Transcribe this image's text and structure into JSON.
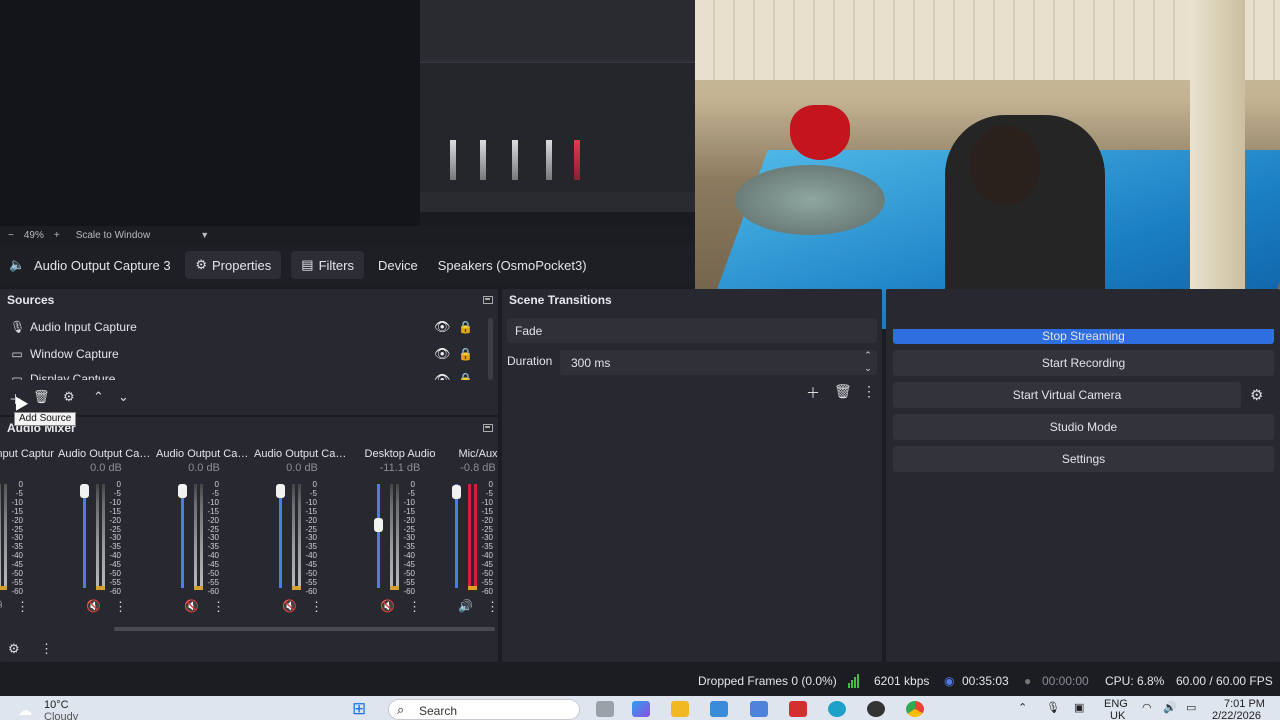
{
  "preview": {
    "zoom": "49%",
    "scale_mode": "Scale to Window"
  },
  "context_bar": {
    "source_name": "Audio Output Capture 3",
    "properties_label": "Properties",
    "filters_label": "Filters",
    "device_label": "Device",
    "device_value": "Speakers (OsmoPocket3)"
  },
  "sources": {
    "title": "Sources",
    "items": [
      {
        "label": "Audio Input Capture",
        "icon": "microphone-icon"
      },
      {
        "label": "Window Capture",
        "icon": "window-icon"
      },
      {
        "label": "Display Capture",
        "icon": "monitor-icon"
      }
    ],
    "tooltip": "Add Source"
  },
  "mixer": {
    "title": "Audio Mixer",
    "channels": [
      {
        "name": "Audio Input Captur",
        "db": "",
        "level": 0.55,
        "fader": 0.0,
        "muted": false
      },
      {
        "name": "Audio Output Captu",
        "db": "0.0 dB",
        "level": 0.0,
        "fader": 1.0,
        "muted": true
      },
      {
        "name": "Audio Output Captu",
        "db": "0.0 dB",
        "level": 0.0,
        "fader": 1.0,
        "muted": true
      },
      {
        "name": "Audio Output Captu",
        "db": "0.0 dB",
        "level": 0.0,
        "fader": 1.0,
        "muted": true
      },
      {
        "name": "Desktop Audio",
        "db": "-11.1 dB",
        "level": 0.0,
        "fader": 0.62,
        "muted": true
      },
      {
        "name": "Mic/Aux",
        "db": "-0.8 dB",
        "level": 0.95,
        "fader": 0.99,
        "muted": false
      }
    ],
    "scale": [
      "0",
      "-5",
      "-10",
      "-15",
      "-20",
      "-25",
      "-30",
      "-35",
      "-40",
      "-45",
      "-50",
      "-55",
      "-60"
    ]
  },
  "transitions": {
    "title": "Scene Transitions",
    "selected": "Fade",
    "duration_label": "Duration",
    "duration_value": "300 ms"
  },
  "controls": {
    "stop_streaming": "Stop Streaming",
    "start_recording": "Start Recording",
    "start_virtual_camera": "Start Virtual Camera",
    "studio_mode": "Studio Mode",
    "settings": "Settings"
  },
  "status": {
    "dropped_frames": "Dropped Frames 0 (0.0%)",
    "bitrate": "6201 kbps",
    "stream_time": "00:35:03",
    "record_time": "00:00:00",
    "cpu": "CPU: 6.8%",
    "fps": "60.00 / 60.00 FPS"
  },
  "taskbar": {
    "weather_temp": "10°C",
    "weather_desc": "Cloudy",
    "search_placeholder": "Search",
    "language": "ENG",
    "region": "UK",
    "time": "7:01 PM",
    "date": "2/22/2026"
  },
  "colors": {
    "accent": "#2f6ee0",
    "panel": "#272830",
    "fader": "#4e7be8",
    "mute_red": "#b3242c",
    "meter_red": "#d21f3c"
  }
}
